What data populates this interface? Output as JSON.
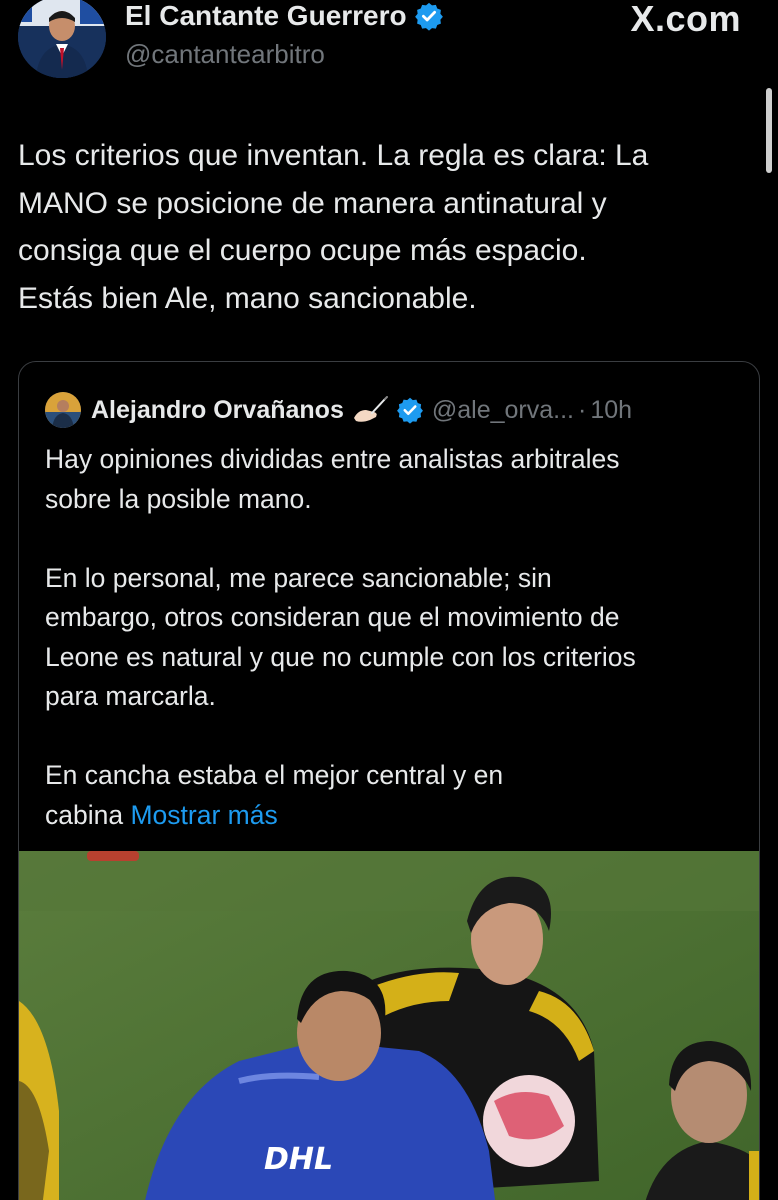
{
  "author": {
    "name": "El Cantante Guerrero",
    "handle": "@cantantearbitro",
    "verified_color": "#1d9bf0"
  },
  "site_logo": "X.com",
  "tweet": {
    "lines": [
      "Los criterios que inventan. La regla es clara: La",
      "MANO se posicione de manera antinatural y",
      "consiga que el cuerpo ocupe más espacio.",
      "Estás bien Ale, mano sancionable."
    ]
  },
  "quote": {
    "name": "Alejandro Orvañanos",
    "emoji_icon": "writing-hand-icon",
    "handle": "@ale_orva...",
    "separator": "·",
    "time": "10h",
    "text": "Hay opiniones divididas entre analistas arbitrales\nsobre la posible mano.\n\nEn lo personal, me parece sancionable; sin\nembargo, otros consideran que el movimiento de\nLeone es natural y que no cumple con los criterios\npara marcarla.\n\nEn cancha estaba el mejor central y en\ncabina ",
    "show_more": "Mostrar más",
    "link_color": "#1d9bf0"
  },
  "photo": {
    "ball_sponsor": "DHL"
  }
}
